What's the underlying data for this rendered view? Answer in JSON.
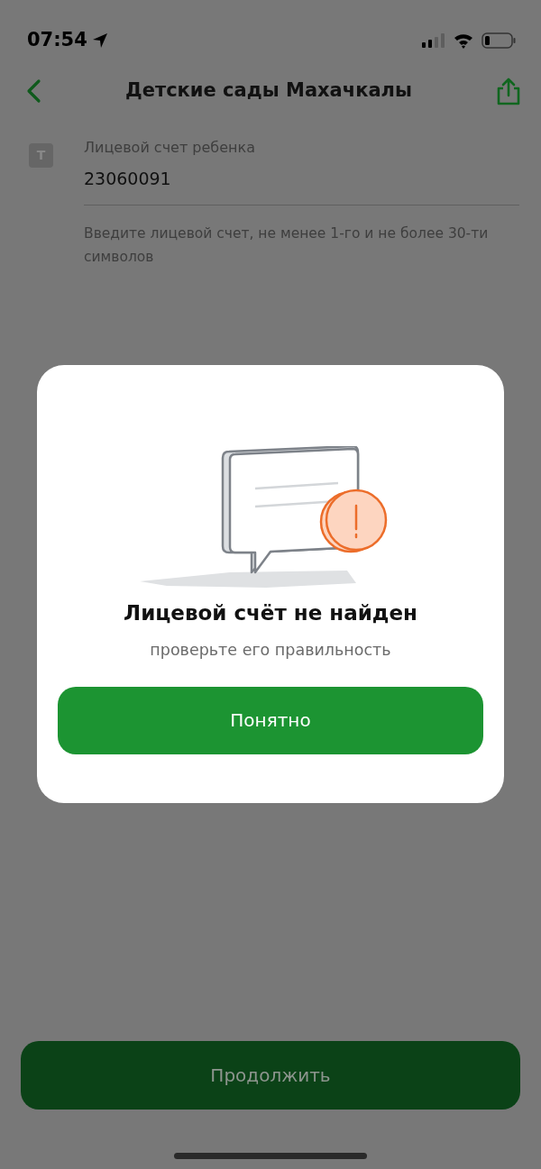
{
  "status_bar": {
    "time": "07:54"
  },
  "header": {
    "title": "Детские сады Махачкалы"
  },
  "field": {
    "type_icon": "T",
    "label": "Лицевой счет ребенка",
    "value": "23060091",
    "hint": "Введите лицевой счет, не менее 1-го и не более 30-ти символов"
  },
  "dialog": {
    "title": "Лицевой счёт не найден",
    "message": "проверьте его правильность",
    "button": "Понятно"
  },
  "primary_button": {
    "label": "Продолжить"
  }
}
